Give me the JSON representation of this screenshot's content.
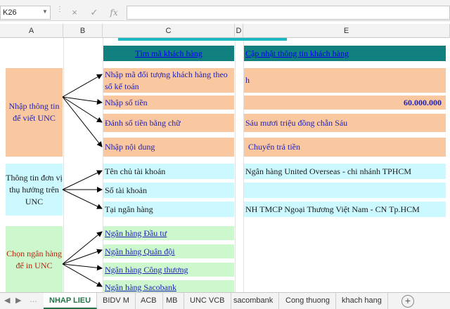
{
  "formula_bar": {
    "name_box": "K26",
    "cancel_icon": "×",
    "enter_icon": "✓",
    "function_icon": "fx",
    "formula_value": ""
  },
  "columns": [
    "A",
    "B",
    "C",
    "D",
    "E"
  ],
  "sheet": {
    "header_links": {
      "find_customer": "Tìm mã khách hàng",
      "update_customer": "Cập nhật thông tin khách hàng"
    },
    "group_input": {
      "label": "Nhập thông tin để viết UNC",
      "rows": [
        {
          "label": "Nhập mã đối tượng khách hàng theo sổ kế toán",
          "value": "h"
        },
        {
          "label": "Nhập số tiền",
          "value": "60.000.000"
        },
        {
          "label": "Đánh số tiền bằng chữ",
          "value": "Sáu mươi triệu đồng chẵn Sáu"
        },
        {
          "label": "Nhập nội dung",
          "value": "Chuyển trả tiền"
        }
      ]
    },
    "group_beneficiary": {
      "label": "Thông tin đơn vị thụ hưởng trên UNC",
      "rows": [
        {
          "label": "Tên chủ tài khoản",
          "value": "Ngân hàng United Overseas - chi nhánh TPHCM"
        },
        {
          "label": "Số tài khoản",
          "value": ""
        },
        {
          "label": "Tại ngân hàng",
          "value": "NH TMCP Ngoại Thương Việt Nam - CN Tp.HCM"
        }
      ]
    },
    "group_bank": {
      "label": "Chọn ngân hàng để in UNC",
      "banks": [
        "Ngân hàng Đầu tư",
        "Ngân hàng Quân đội",
        "Ngân hàng Công thương",
        "Ngân hàng Sacobank"
      ]
    }
  },
  "sheet_tabs": [
    "NHAP LIEU",
    "BIDV M",
    "ACB",
    "MB",
    "UNC VCB",
    "sacombank",
    "Cong thuong",
    "khach hang"
  ],
  "active_tab": "NHAP LIEU",
  "add_sheet_label": "+",
  "colors": {
    "peach": "#fac8a0",
    "cyan": "#ccf8ff",
    "green": "#cdf7cd",
    "teal": "#12807e",
    "text_navy": "#1f1fb4"
  }
}
